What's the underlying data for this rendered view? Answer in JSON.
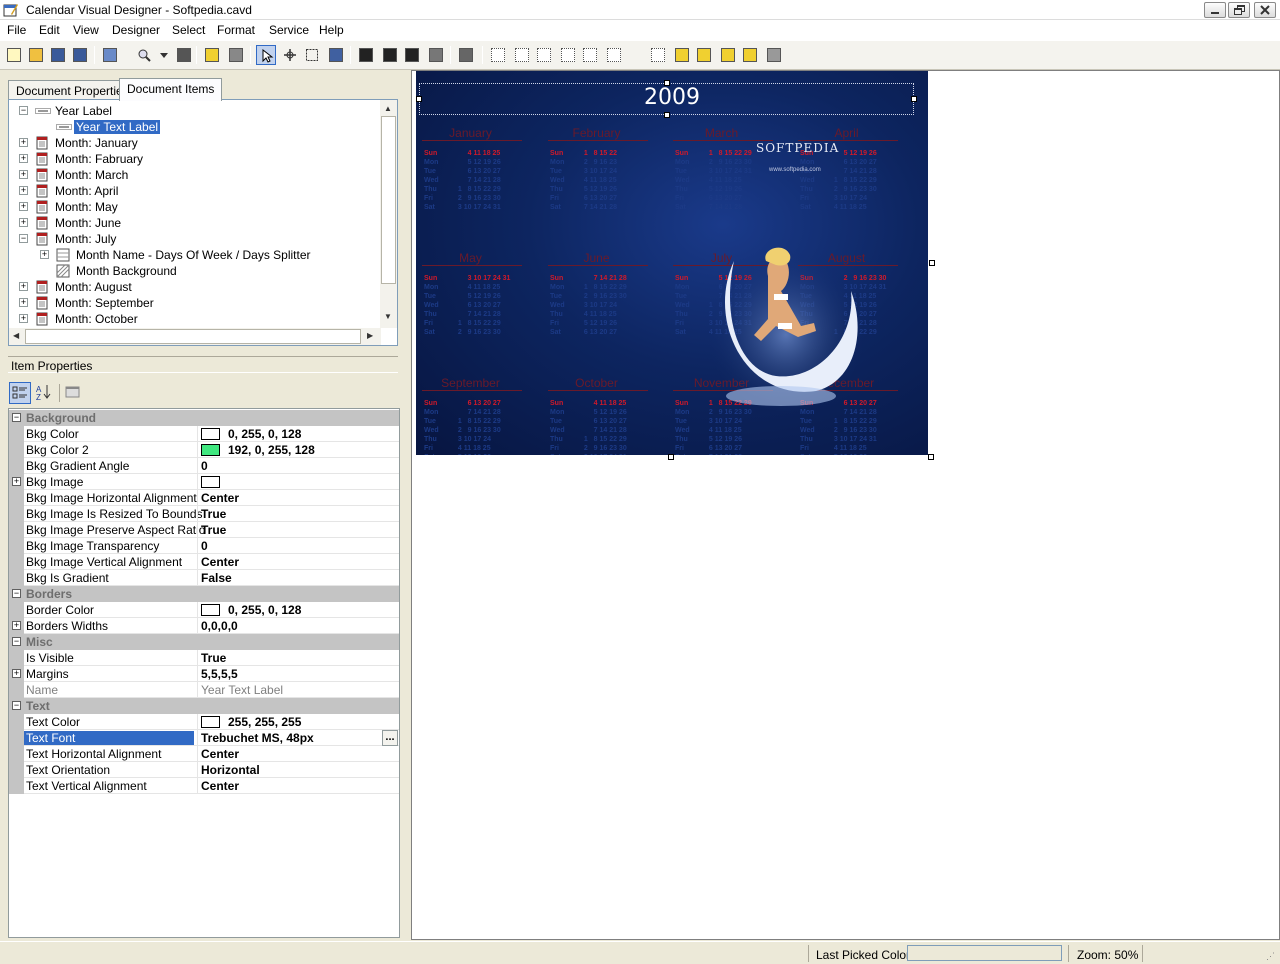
{
  "window": {
    "title": "Calendar Visual Designer - Softpedia.cavd"
  },
  "menu": [
    "File",
    "Edit",
    "View",
    "Designer",
    "Select",
    "Format",
    "Service",
    "Help"
  ],
  "toolbar_icons": [
    "new-icon",
    "open-icon",
    "save-icon",
    "save-all-icon",
    "print-preview-icon",
    "zoom-icon",
    "zoom-dropdown-icon",
    "layout-icon",
    "add-item-icon",
    "delete-item-icon",
    "pointer-icon",
    "move-icon",
    "marquee-select-icon",
    "pick-color-icon",
    "fit-width-icon",
    "fit-height-icon",
    "fit-page-icon",
    "grid-icon",
    "order-icon",
    "align-left-icon",
    "align-center-icon",
    "align-top-icon",
    "align-bottom-icon",
    "center-horizontal-icon",
    "center-vertical-icon",
    "distribute-icon",
    "bring-front-icon",
    "send-back-icon",
    "bring-forward-icon",
    "send-backward-icon",
    "group-icon"
  ],
  "tabs": [
    {
      "label": "Document Properties",
      "active": false
    },
    {
      "label": "Document Items",
      "active": true
    }
  ],
  "tree": [
    {
      "label": "Year Label",
      "indent": 0,
      "expander": "−",
      "icon": "text-label-icon"
    },
    {
      "label": "Year Text Label",
      "indent": 1,
      "expander": "",
      "icon": "text-label-icon",
      "selected": true
    },
    {
      "label": "Month: January",
      "indent": 0,
      "expander": "+",
      "icon": "calendar-month-icon"
    },
    {
      "label": "Month: Fabruary",
      "indent": 0,
      "expander": "+",
      "icon": "calendar-month-icon"
    },
    {
      "label": "Month: March",
      "indent": 0,
      "expander": "+",
      "icon": "calendar-month-icon"
    },
    {
      "label": "Month: April",
      "indent": 0,
      "expander": "+",
      "icon": "calendar-month-icon"
    },
    {
      "label": "Month: May",
      "indent": 0,
      "expander": "+",
      "icon": "calendar-month-icon"
    },
    {
      "label": "Month: June",
      "indent": 0,
      "expander": "+",
      "icon": "calendar-month-icon"
    },
    {
      "label": "Month: July",
      "indent": 0,
      "expander": "−",
      "icon": "calendar-month-icon"
    },
    {
      "label": "Month Name - Days Of Week / Days Splitter",
      "indent": 1,
      "expander": "+",
      "icon": "grid-cells-icon"
    },
    {
      "label": "Month Background",
      "indent": 1,
      "expander": "",
      "icon": "background-hatch-icon"
    },
    {
      "label": "Month: August",
      "indent": 0,
      "expander": "+",
      "icon": "calendar-month-icon"
    },
    {
      "label": "Month: September",
      "indent": 0,
      "expander": "+",
      "icon": "calendar-month-icon"
    },
    {
      "label": "Month: October",
      "indent": 0,
      "expander": "+",
      "icon": "calendar-month-icon"
    }
  ],
  "item_properties": {
    "label": "Item Properties"
  },
  "propgrid": [
    {
      "type": "cat",
      "name": "Background"
    },
    {
      "name": "Bkg Color",
      "value": "0, 255, 0, 128",
      "swatch": "#ffffff"
    },
    {
      "name": "Bkg Color 2",
      "value": "192, 0, 255, 128",
      "swatch": "#40e880"
    },
    {
      "name": "Bkg Gradient Angle",
      "value": "0"
    },
    {
      "name": "Bkg Image",
      "value": "",
      "swatch": "#ffffff",
      "expand": true
    },
    {
      "name": "Bkg Image Horizontal Alignment",
      "value": "Center"
    },
    {
      "name": "Bkg Image Is Resized To Bounds",
      "value": "True"
    },
    {
      "name": "Bkg Image Preserve Aspect Ratio",
      "value": "True"
    },
    {
      "name": "Bkg Image Transparency",
      "value": "0"
    },
    {
      "name": "Bkg Image Vertical Alignment",
      "value": "Center"
    },
    {
      "name": "Bkg Is Gradient",
      "value": "False"
    },
    {
      "type": "cat",
      "name": "Borders"
    },
    {
      "name": "Border Color",
      "value": "0, 255, 0, 128",
      "swatch": "#ffffff"
    },
    {
      "name": "Borders Widths",
      "value": "0,0,0,0",
      "expand": true
    },
    {
      "type": "cat",
      "name": "Misc"
    },
    {
      "name": "Is Visible",
      "value": "True"
    },
    {
      "name": "Margins",
      "value": "5,5,5,5",
      "expand": true
    },
    {
      "name": "Name",
      "value": "Year Text Label",
      "dim": true
    },
    {
      "type": "cat",
      "name": "Text"
    },
    {
      "name": "Text Color",
      "value": "255, 255, 255",
      "swatch": "#ffffff"
    },
    {
      "name": "Text Font",
      "value": "Trebuchet MS, 48px",
      "selected": true,
      "ellipsis": "..."
    },
    {
      "name": "Text Horizontal Alignment",
      "value": "Center"
    },
    {
      "name": "Text Orientation",
      "value": "Horizontal"
    },
    {
      "name": "Text Vertical Alignment",
      "value": "Center"
    }
  ],
  "calendar": {
    "year": "2009",
    "logo": "SOFTPEDIA",
    "logo_url": "www.softpedia.com",
    "days": [
      "Sun",
      "Mon",
      "Tue",
      "Wed",
      "Thu",
      "Fri",
      "Sat"
    ],
    "months": [
      {
        "name": "January",
        "row": 0,
        "col": 0,
        "first": 4
      },
      {
        "name": "February",
        "row": 0,
        "col": 1,
        "first": 0
      },
      {
        "name": "March",
        "row": 0,
        "col": 2,
        "first": 0
      },
      {
        "name": "April",
        "row": 0,
        "col": 3,
        "first": 3
      },
      {
        "name": "May",
        "row": 1,
        "col": 0,
        "first": 5
      },
      {
        "name": "June",
        "row": 1,
        "col": 1,
        "first": 1
      },
      {
        "name": "July",
        "row": 1,
        "col": 2,
        "first": 3
      },
      {
        "name": "August",
        "row": 1,
        "col": 3,
        "first": 6
      },
      {
        "name": "September",
        "row": 2,
        "col": 0,
        "first": 2
      },
      {
        "name": "October",
        "row": 2,
        "col": 1,
        "first": 4
      },
      {
        "name": "November",
        "row": 2,
        "col": 2,
        "first": 0
      },
      {
        "name": "December",
        "row": 2,
        "col": 3,
        "first": 2
      }
    ],
    "month_lengths": [
      31,
      28,
      31,
      30,
      31,
      30,
      31,
      31,
      30,
      31,
      30,
      31
    ]
  },
  "status": {
    "last_picked_label": "Last Picked Color:",
    "zoom": "Zoom: 50%"
  }
}
